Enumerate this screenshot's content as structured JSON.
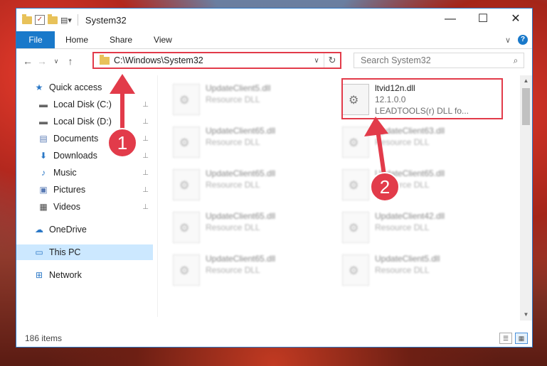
{
  "window": {
    "title": "System32",
    "controls": {
      "minimize": "—",
      "maximize": "☐",
      "close": "✕"
    }
  },
  "ribbon": {
    "file": "File",
    "tabs": [
      "Home",
      "Share",
      "View"
    ],
    "help": "?",
    "expand": "∨"
  },
  "nav": {
    "back": "←",
    "forward": "→",
    "recent": "∨",
    "up": "↑"
  },
  "address": {
    "path": "C:\\Windows\\System32",
    "refresh": "↻",
    "dropdown": "∨"
  },
  "search": {
    "placeholder": "Search System32",
    "icon": "search-icon"
  },
  "sidebar": {
    "items": [
      {
        "label": "Quick access",
        "icon": "star-icon",
        "glyph": "★",
        "color": "#2b78c6",
        "pinned": false
      },
      {
        "label": "Local Disk (C:)",
        "icon": "drive-icon",
        "glyph": "▬",
        "color": "#666666",
        "pinned": true
      },
      {
        "label": "Local Disk (D:)",
        "icon": "drive-icon",
        "glyph": "▬",
        "color": "#666666",
        "pinned": true
      },
      {
        "label": "Documents",
        "icon": "documents-icon",
        "glyph": "▤",
        "color": "#5a7bb5",
        "pinned": true
      },
      {
        "label": "Downloads",
        "icon": "download-icon",
        "glyph": "⬇",
        "color": "#2b78c6",
        "pinned": true
      },
      {
        "label": "Music",
        "icon": "music-icon",
        "glyph": "♪",
        "color": "#2b78c6",
        "pinned": true
      },
      {
        "label": "Pictures",
        "icon": "pictures-icon",
        "glyph": "▣",
        "color": "#5a7bb5",
        "pinned": true
      },
      {
        "label": "Videos",
        "icon": "videos-icon",
        "glyph": "▦",
        "color": "#444444",
        "pinned": true
      },
      {
        "label": "OneDrive",
        "icon": "cloud-icon",
        "glyph": "☁",
        "color": "#2b78c6",
        "pinned": false
      },
      {
        "label": "This PC",
        "icon": "computer-icon",
        "glyph": "▭",
        "color": "#2b78c6",
        "pinned": false
      },
      {
        "label": "Network",
        "icon": "network-icon",
        "glyph": "⊞",
        "color": "#2b78c6",
        "pinned": false
      }
    ],
    "pin_glyph": "📌"
  },
  "files": [
    {
      "name": "UpdateClient5.dll",
      "line2": "Resource DLL",
      "line3": "",
      "blurred": true
    },
    {
      "name": "ltvid12n.dll",
      "line2": "12.1.0.0",
      "line3": "LEADTOOLS(r) DLL fo...",
      "blurred": false
    },
    {
      "name": "UpdateClient65.dll",
      "line2": "Resource DLL",
      "line3": "",
      "blurred": true
    },
    {
      "name": "UpdateClient63.dll",
      "line2": "Resource DLL",
      "line3": "",
      "blurred": true
    },
    {
      "name": "UpdateClient65.dll",
      "line2": "Resource DLL",
      "line3": "",
      "blurred": true
    },
    {
      "name": "UpdateClient65.dll",
      "line2": "Resource DLL",
      "line3": "",
      "blurred": true
    },
    {
      "name": "UpdateClient65.dll",
      "line2": "Resource DLL",
      "line3": "",
      "blurred": true
    },
    {
      "name": "UpdateClient42.dll",
      "line2": "Resource DLL",
      "line3": "",
      "blurred": true
    },
    {
      "name": "UpdateClient65.dll",
      "line2": "Resource DLL",
      "line3": "",
      "blurred": true
    },
    {
      "name": "UpdateClient5.dll",
      "line2": "Resource DLL",
      "line3": "",
      "blurred": true
    }
  ],
  "status": {
    "count": "186 items"
  },
  "annotations": {
    "step1": "1",
    "step2": "2",
    "color": "#e23b4a"
  }
}
